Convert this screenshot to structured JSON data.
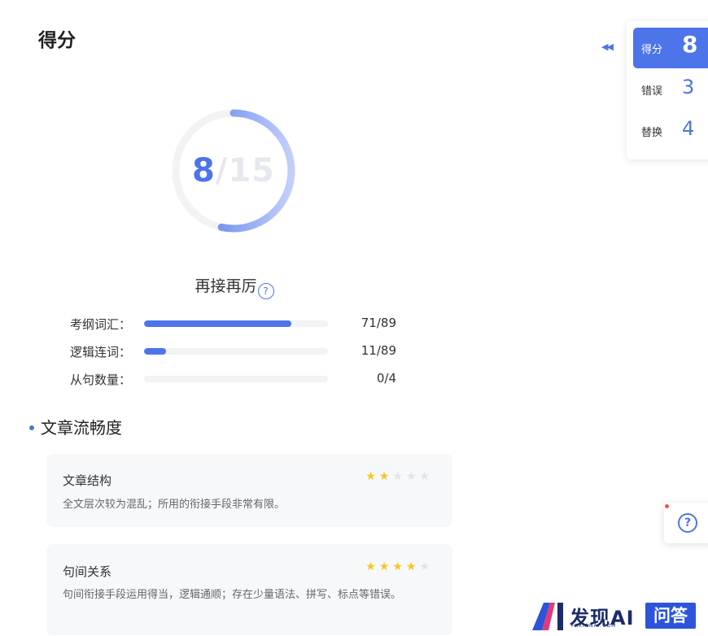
{
  "page": {
    "title": "得分"
  },
  "score": {
    "obtained": "8",
    "separator": "/",
    "total": "15",
    "obtained_value": 8,
    "total_value": 15,
    "ring_color": "#4d74e8",
    "track_color": "#f2f3f5"
  },
  "level": {
    "text": "再接再厉",
    "help_icon": "?"
  },
  "stats": [
    {
      "label": "考纲词汇：",
      "value": "71/89",
      "fraction": 0.8
    },
    {
      "label": "逻辑连词：",
      "value": "11/89",
      "fraction": 0.12
    },
    {
      "label": "从句数量：",
      "value": "0/4",
      "fraction": 0.0
    }
  ],
  "fluency": {
    "title": "文章流畅度",
    "cards": [
      {
        "title": "文章结构",
        "stars": 2,
        "max_stars": 5,
        "desc": "全文层次较为混乱；所用的衔接手段非常有限。"
      },
      {
        "title": "句间关系",
        "stars": 4,
        "max_stars": 5,
        "desc": "句间衔接手段运用得当，逻辑通顺；存在少量语法、拼写、标点等错误。"
      }
    ]
  },
  "sidebar": {
    "collapse_icon": "◀◀",
    "items": [
      {
        "label": "得分",
        "value": "8",
        "active": true
      },
      {
        "label": "错误",
        "value": "3",
        "active": false
      },
      {
        "label": "替换",
        "value": "4",
        "active": false
      }
    ],
    "help_icon": "?"
  },
  "watermark": {
    "brand": "发现AI",
    "sub": "FAXIANAI.COM",
    "box": "问答"
  },
  "colors": {
    "accent": "#4d74e8",
    "star_on": "#f9c51b",
    "star_off": "#e3e4e8"
  }
}
